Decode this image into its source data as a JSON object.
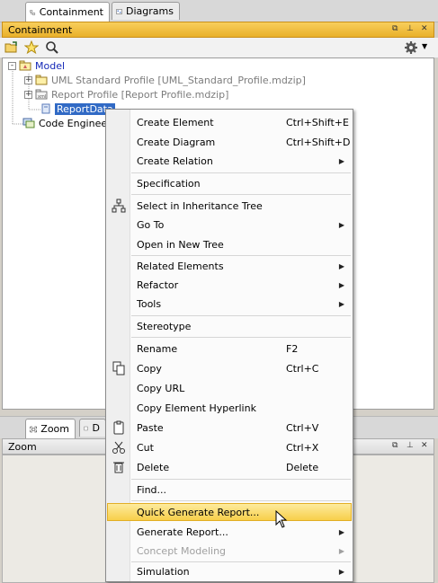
{
  "top_tabs": [
    {
      "label": "Containment",
      "icon": "containment-icon",
      "active": true
    },
    {
      "label": "Diagrams",
      "icon": "diagrams-icon",
      "active": false
    }
  ],
  "containment_panel": {
    "title": "Containment",
    "toolbar": {
      "icons": [
        "open-folder-icon",
        "star-icon",
        "search-icon",
        "gear-icon",
        "chevron-down-icon"
      ]
    },
    "tree": [
      {
        "label": "Model",
        "style": "blue",
        "icon": "package-icon",
        "expander": "-"
      },
      {
        "label": "UML Standard Profile [UML_Standard_Profile.mdzip]",
        "style": "gray",
        "icon": "package-icon",
        "expander": "+"
      },
      {
        "label": "Report Profile [Report Profile.mdzip]",
        "style": "gray",
        "icon": "profile-icon",
        "expander": "+"
      },
      {
        "label": "ReportData",
        "style": "selected",
        "icon": "data-icon",
        "expander": ""
      },
      {
        "label": "Code Engineerin",
        "style": "normal",
        "icon": "code-engineering-icon",
        "expander": ""
      }
    ]
  },
  "bottom_tabs": [
    {
      "label": "Zoom",
      "icon": "zoom-icon",
      "active": true
    },
    {
      "label": "D",
      "icon": "document-icon",
      "active": false
    }
  ],
  "zoom_panel": {
    "title": "Zoom"
  },
  "context_menu": {
    "items": [
      {
        "label": "Create Element",
        "shortcut": "Ctrl+Shift+E",
        "submenu": false
      },
      {
        "label": "Create Diagram",
        "shortcut": "Ctrl+Shift+D",
        "submenu": false
      },
      {
        "label": "Create Relation",
        "shortcut": "",
        "submenu": true
      },
      {
        "label": "Specification",
        "shortcut": "",
        "submenu": false
      },
      {
        "label": "Select in Inheritance Tree",
        "shortcut": "",
        "submenu": false,
        "icon": "hierarchy-icon"
      },
      {
        "label": "Go To",
        "shortcut": "",
        "submenu": true
      },
      {
        "label": "Open in New Tree",
        "shortcut": "",
        "submenu": false
      },
      {
        "label": "Related Elements",
        "shortcut": "",
        "submenu": true
      },
      {
        "label": "Refactor",
        "shortcut": "",
        "submenu": true
      },
      {
        "label": "Tools",
        "shortcut": "",
        "submenu": true
      },
      {
        "label": "Stereotype",
        "shortcut": "",
        "submenu": false
      },
      {
        "label": "Rename",
        "shortcut": "F2",
        "submenu": false
      },
      {
        "label": "Copy",
        "shortcut": "Ctrl+C",
        "submenu": false,
        "icon": "copy-icon"
      },
      {
        "label": "Copy URL",
        "shortcut": "",
        "submenu": false
      },
      {
        "label": "Copy Element Hyperlink",
        "shortcut": "",
        "submenu": false
      },
      {
        "label": "Paste",
        "shortcut": "Ctrl+V",
        "submenu": false,
        "icon": "paste-icon"
      },
      {
        "label": "Cut",
        "shortcut": "Ctrl+X",
        "submenu": false,
        "icon": "scissors-icon"
      },
      {
        "label": "Delete",
        "shortcut": "Delete",
        "submenu": false,
        "icon": "trash-icon"
      },
      {
        "label": "Find...",
        "shortcut": "",
        "submenu": false
      },
      {
        "label": "Quick Generate Report...",
        "shortcut": "",
        "submenu": false,
        "highlighted": true
      },
      {
        "label": "Generate Report...",
        "shortcut": "",
        "submenu": true
      },
      {
        "label": "Concept Modeling",
        "shortcut": "",
        "submenu": true,
        "disabled": true
      },
      {
        "label": "Simulation",
        "shortcut": "",
        "submenu": true
      }
    ]
  },
  "colors": {
    "panel_header": "#f0c040",
    "selection": "#316ac5",
    "menu_highlight": "#f7cf4a",
    "model_link": "#1428b8"
  }
}
